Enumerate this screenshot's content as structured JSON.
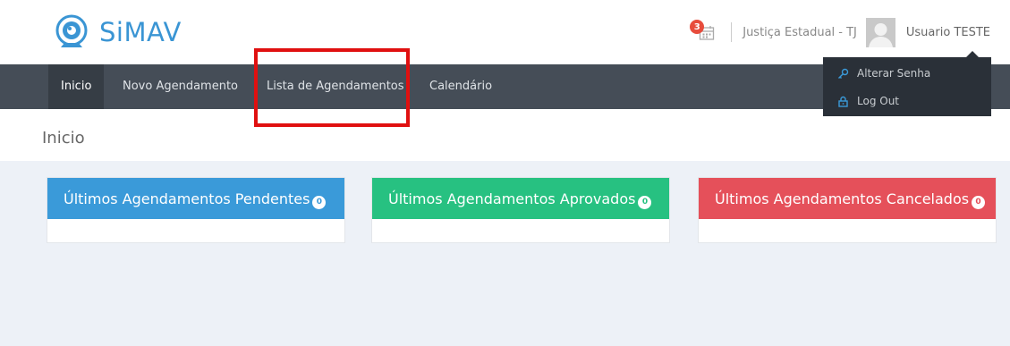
{
  "app": {
    "name": "SiMAV",
    "brand_color": "#3a95d4"
  },
  "header": {
    "notification_count": "3",
    "tribunal": "Justiça Estadual - TJ",
    "username": "Usuario TESTE"
  },
  "nav": {
    "items": [
      {
        "label": "Inicio",
        "active": true
      },
      {
        "label": "Novo Agendamento",
        "active": false
      },
      {
        "label": "Lista de Agendamentos",
        "active": false
      },
      {
        "label": "Calendário",
        "active": false
      }
    ]
  },
  "user_menu": {
    "items": [
      {
        "label": "Alterar Senha",
        "icon": "key-icon"
      },
      {
        "label": "Log Out",
        "icon": "lock-icon"
      }
    ]
  },
  "page": {
    "title": "Inicio"
  },
  "cards": [
    {
      "title": "Últimos Agendamentos Pendentes",
      "count": "0",
      "color": "#3a9ad9"
    },
    {
      "title": "Últimos Agendamentos Aprovados",
      "count": "0",
      "color": "#27c181"
    },
    {
      "title": "Últimos Agendamentos Cancelados",
      "count": "0",
      "color": "#e5505a"
    }
  ]
}
